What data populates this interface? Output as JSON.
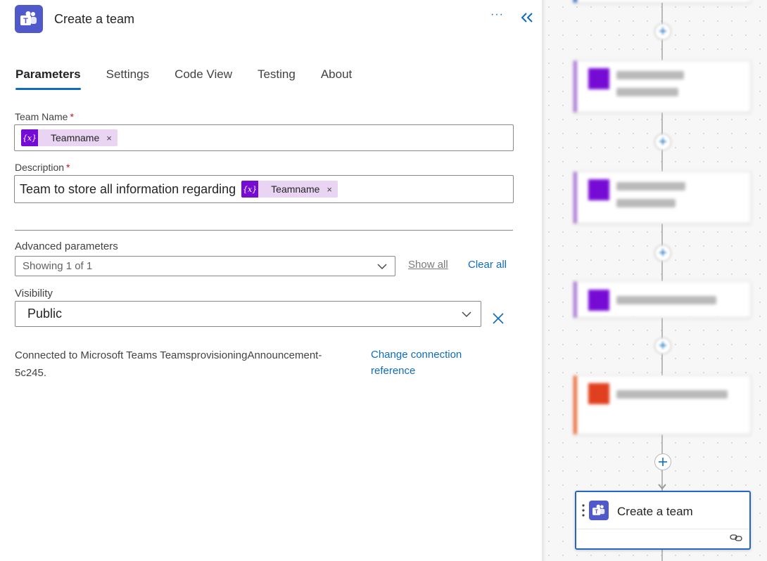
{
  "header": {
    "title": "Create a team",
    "app_icon": "teams-icon",
    "more_label": "···",
    "collapse_icon": "double-chevron-left-icon"
  },
  "tabs": [
    {
      "label": "Parameters",
      "active": true
    },
    {
      "label": "Settings",
      "active": false
    },
    {
      "label": "Code View",
      "active": false
    },
    {
      "label": "Testing",
      "active": false
    },
    {
      "label": "About",
      "active": false
    }
  ],
  "team_name": {
    "label": "Team Name",
    "required_mark": "*",
    "token": {
      "icon_text": "{x}",
      "text": "Teamname",
      "remove": "×"
    }
  },
  "description": {
    "label": "Description",
    "required_mark": "*",
    "text": "Team to store all information regarding",
    "token": {
      "icon_text": "{x}",
      "text": "Teamname",
      "remove": "×"
    }
  },
  "advanced": {
    "label": "Advanced parameters",
    "select_value": "Showing 1 of 1",
    "show_all": "Show all",
    "clear_all": "Clear all"
  },
  "visibility": {
    "label": "Visibility",
    "value": "Public"
  },
  "connection": {
    "text": "Connected to Microsoft Teams TeamsprovisioningAnnouncement-5c245.",
    "change_link": "Change connection reference"
  },
  "canvas": {
    "selected_card_title": "Create a team",
    "colors": {
      "accent": "#0f6cbd",
      "variable": "#770bd6",
      "teams": "#5059c9",
      "office": "#e0401f"
    }
  }
}
